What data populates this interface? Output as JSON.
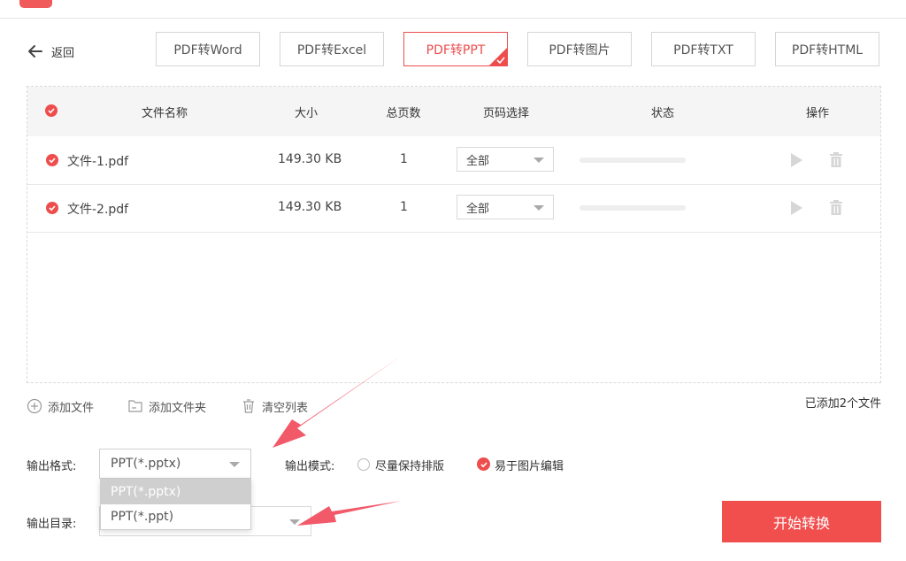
{
  "header": {
    "back_label": "返回"
  },
  "tabs": [
    {
      "label": "PDF转Word"
    },
    {
      "label": "PDF转Excel"
    },
    {
      "label": "PDF转PPT"
    },
    {
      "label": "PDF转图片"
    },
    {
      "label": "PDF转TXT"
    },
    {
      "label": "PDF转HTML"
    }
  ],
  "active_tab": "PDF转PPT",
  "table": {
    "columns": [
      "文件名称",
      "大小",
      "总页数",
      "页码选择",
      "状态",
      "操作"
    ],
    "rows": [
      {
        "name": "文件-1.pdf",
        "size": "149.30 KB",
        "pages": "1",
        "page_select": "全部"
      },
      {
        "name": "文件-2.pdf",
        "size": "149.30 KB",
        "pages": "1",
        "page_select": "全部"
      }
    ]
  },
  "toolbar": {
    "add_file": "添加文件",
    "add_folder": "添加文件夹",
    "clear_list": "清空列表",
    "count_text": "已添加2个文件"
  },
  "output": {
    "format_label": "输出格式:",
    "format_value": "PPT(*.pptx)",
    "format_options": [
      "PPT(*.pptx)",
      "PPT(*.ppt)"
    ],
    "mode_label": "输出模式:",
    "mode_options": [
      "尽量保持排版",
      "易于图片编辑"
    ],
    "mode_selected": "易于图片编辑",
    "dir_label": "输出目录:"
  },
  "start_button": "开始转换",
  "colors": {
    "accent": "#ee4d4d",
    "button": "#f14e4e"
  }
}
